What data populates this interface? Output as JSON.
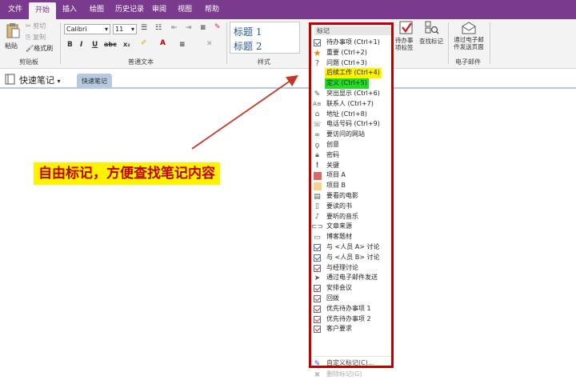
{
  "ribbon": {
    "tabs": [
      "文件",
      "开始",
      "插入",
      "绘图",
      "历史记录",
      "审阅",
      "视图",
      "帮助"
    ],
    "active_tab": "开始",
    "clipboard": {
      "paste": "粘贴",
      "cut": "剪切",
      "copy": "复制",
      "format_painter": "格式刷",
      "label": "剪贴板"
    },
    "font": {
      "name": "Calibri",
      "size": "11",
      "bold": "B",
      "italic": "I",
      "underline": "U",
      "strike": "abc",
      "label": "普通文本"
    },
    "styles": {
      "heading1": "标题 1",
      "heading2": "标题 2",
      "label": "样式"
    },
    "tags_group": {
      "todo": "待办事项标签",
      "find": "查找标记"
    },
    "email": {
      "send": "通过电子邮件发送页面",
      "label": "电子邮件"
    }
  },
  "notebook": {
    "title": "快速笔记",
    "page_tab": "快速笔记"
  },
  "annotation": "自由标记，方便查找笔记内容",
  "dropdown": {
    "header": "标记",
    "items": [
      {
        "label": "待办事项 (Ctrl+1)",
        "icon": "checkbox-icon"
      },
      {
        "label": "重要 (Ctrl+2)",
        "icon": "star-icon"
      },
      {
        "label": "问题 (Ctrl+3)",
        "icon": "question-icon"
      },
      {
        "label": "后续工作 (Ctrl+4)",
        "icon": "highlight-yellow",
        "highlight": "yellow"
      },
      {
        "label": "定义 (Ctrl+5)",
        "icon": "highlight-green",
        "highlight": "green"
      },
      {
        "label": "突出显示 (Ctrl+6)",
        "icon": "pen-icon"
      },
      {
        "label": "联系人 (Ctrl+7)",
        "icon": "contact-icon"
      },
      {
        "label": "地址 (Ctrl+8)",
        "icon": "house-icon"
      },
      {
        "label": "电话号码 (Ctrl+9)",
        "icon": "phone-icon"
      },
      {
        "label": "要访问的网站",
        "icon": "link-icon"
      },
      {
        "label": "创意",
        "icon": "bulb-icon"
      },
      {
        "label": "密码",
        "icon": "lock-icon"
      },
      {
        "label": "关键",
        "icon": "exclamation-icon"
      },
      {
        "label": "项目 A",
        "icon": "project-a-square",
        "color": "#e06666"
      },
      {
        "label": "项目 B",
        "icon": "project-b-square",
        "color": "#f6d28c"
      },
      {
        "label": "要看的电影",
        "icon": "film-icon"
      },
      {
        "label": "要读的书",
        "icon": "book-icon"
      },
      {
        "label": "要听的音乐",
        "icon": "music-icon"
      },
      {
        "label": "文章来源",
        "icon": "source-icon"
      },
      {
        "label": "博客题材",
        "icon": "speech-icon"
      },
      {
        "label": "与 <人员 A> 讨论",
        "icon": "checkbox-icon"
      },
      {
        "label": "与 <人员 B> 讨论",
        "icon": "checkbox-icon"
      },
      {
        "label": "与经理讨论",
        "icon": "checkbox-icon"
      },
      {
        "label": "通过电子邮件发送",
        "icon": "send-icon"
      },
      {
        "label": "安排会议",
        "icon": "checkbox-icon"
      },
      {
        "label": "回拨",
        "icon": "checkbox-icon"
      },
      {
        "label": "优先待办事项 1",
        "icon": "checkbox-icon"
      },
      {
        "label": "优先待办事项 2",
        "icon": "checkbox-icon"
      },
      {
        "label": "客户要求",
        "icon": "checkbox-icon"
      }
    ],
    "customize": "自定义标记(C)...",
    "remove": "删除标记(G)"
  },
  "colors": {
    "accent": "#7a3b8f",
    "frame": "#c00000",
    "annotation_bg": "#fff200",
    "annotation_text": "#c00000"
  }
}
